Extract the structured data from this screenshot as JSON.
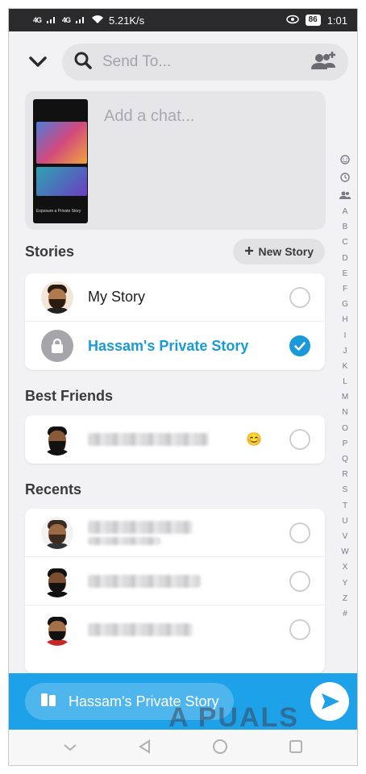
{
  "status_bar": {
    "network_left": "4G",
    "network_left2": "4G",
    "speed": "5.21K/s",
    "battery": "86",
    "time": "1:01"
  },
  "search": {
    "placeholder": "Send To..."
  },
  "preview": {
    "chat_placeholder": "Add a chat...",
    "thumbnail_caption": "Exposure a Private Story"
  },
  "stories": {
    "title": "Stories",
    "new_story_label": "New Story",
    "items": [
      {
        "label": "My Story",
        "checked": false
      },
      {
        "label": "Hassam's Private Story",
        "checked": true
      }
    ]
  },
  "best_friends": {
    "title": "Best Friends",
    "emoji": "😊"
  },
  "recents": {
    "title": "Recents"
  },
  "alphabet": [
    "A",
    "B",
    "C",
    "D",
    "E",
    "F",
    "G",
    "H",
    "I",
    "J",
    "K",
    "L",
    "M",
    "N",
    "O",
    "P",
    "Q",
    "R",
    "S",
    "T",
    "U",
    "V",
    "W",
    "X",
    "Y",
    "Z",
    "#"
  ],
  "send_bar": {
    "selected_label": "Hassam's Private Story"
  },
  "watermark": "A PUALS",
  "colors": {
    "accent": "#1da1e8",
    "selected_text": "#1a9ad9"
  }
}
